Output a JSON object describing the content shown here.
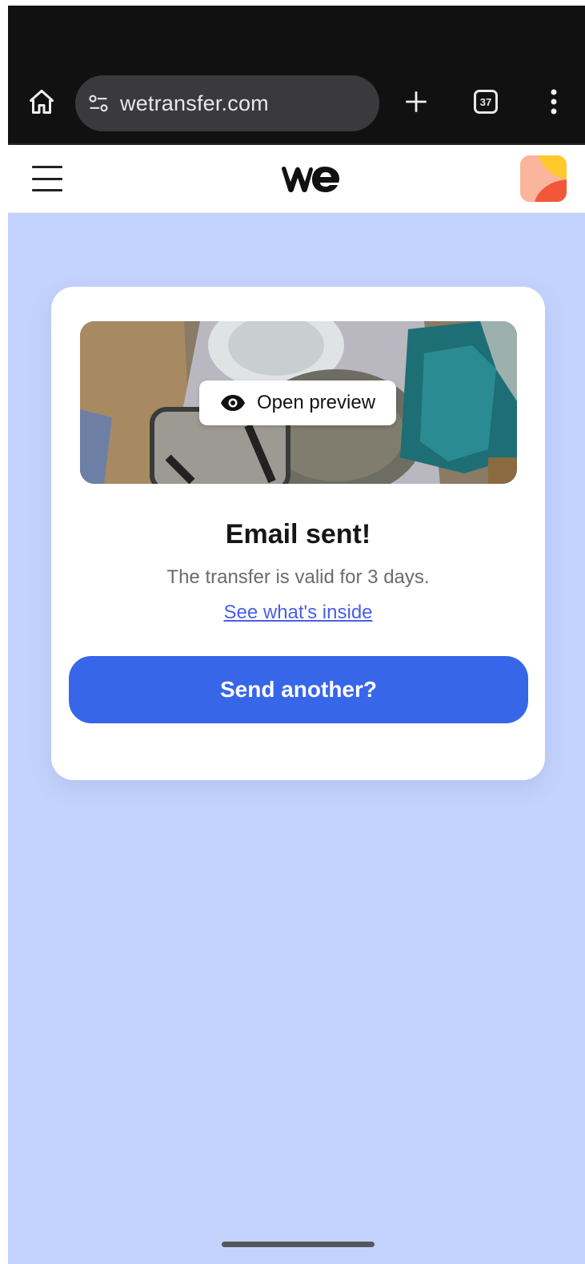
{
  "browser": {
    "url": "wetransfer.com",
    "tab_count": "37",
    "home_icon": "home-icon",
    "site_settings_icon": "tune-icon",
    "new_tab_icon": "plus-icon",
    "more_icon": "more-vert-icon"
  },
  "header": {
    "menu_icon": "hamburger-menu-icon",
    "logo_text": "we",
    "app_icon": "app-badge-icon"
  },
  "card": {
    "preview_button_label": "Open preview",
    "preview_icon": "eye-icon",
    "title": "Email sent!",
    "subtitle": "The transfer is valid for 3 days.",
    "link_text": "See what's inside",
    "primary_button_label": "Send another?"
  },
  "colors": {
    "page_background": "#c4d3fd",
    "primary_button": "#3866e9",
    "link": "#4a5ee8",
    "browser_chrome": "#111111"
  }
}
